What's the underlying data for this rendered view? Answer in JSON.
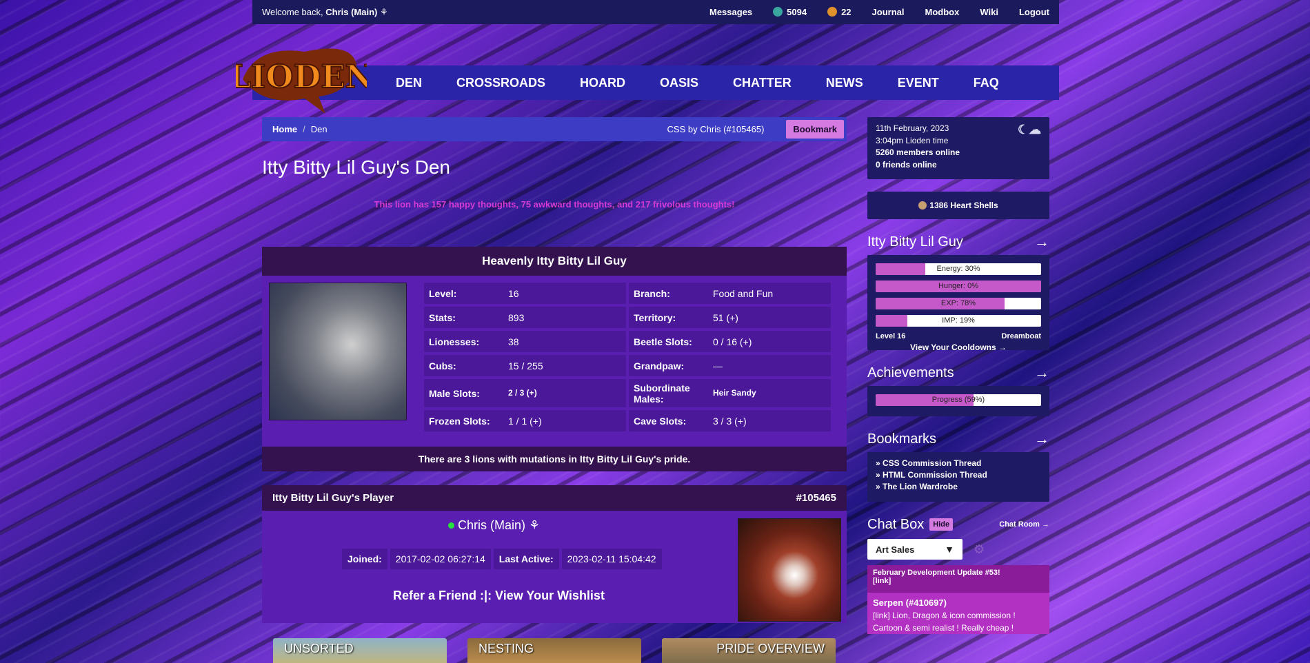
{
  "topbar": {
    "welcome_prefix": "Welcome back,",
    "user": "Chris (Main)",
    "messages": "Messages",
    "beetles": "5094",
    "gifts": "22",
    "journal": "Journal",
    "modbox": "Modbox",
    "wiki": "Wiki",
    "logout": "Logout"
  },
  "logo_text": "LIODEN",
  "nav": [
    "DEN",
    "CROSSROADS",
    "HOARD",
    "OASIS",
    "CHATTER",
    "NEWS",
    "EVENT",
    "FAQ"
  ],
  "breadcrumb": {
    "home": "Home",
    "sep": "/",
    "current": "Den",
    "css": "CSS by Chris (#105465)",
    "bookmark": "Bookmark"
  },
  "page_title": "Itty Bitty Lil Guy's Den",
  "thoughts": "This lion has 157 happy thoughts, 75 awkward thoughts, and 217 frivolous thoughts!",
  "lion": {
    "name": "Heavenly Itty Bitty Lil Guy",
    "stats": [
      {
        "k": "Level:",
        "v": "16"
      },
      {
        "k": "Branch:",
        "v": "Food and Fun"
      },
      {
        "k": "Stats:",
        "v": "893"
      },
      {
        "k": "Territory:",
        "v": "51 (+)"
      },
      {
        "k": "Lionesses:",
        "v": "38"
      },
      {
        "k": "Beetle Slots:",
        "v": "0 / 16 (+)"
      },
      {
        "k": "Cubs:",
        "v": "15 / 255"
      },
      {
        "k": "Grandpaw:",
        "v": "—"
      },
      {
        "k": "Male Slots:",
        "v": "2 / 3 (+)"
      },
      {
        "k": "Subordinate Males:",
        "v": "Heir Sandy"
      },
      {
        "k": "Frozen Slots:",
        "v": "1 / 1 (+)"
      },
      {
        "k": "Cave Slots:",
        "v": "3 / 3 (+)"
      }
    ],
    "mutation": "There are 3 lions with mutations in Itty Bitty Lil Guy's pride."
  },
  "player": {
    "heading": "Itty Bitty Lil Guy's Player",
    "id": "#105465",
    "name": "Chris (Main)",
    "joined_label": "Joined:",
    "joined": "2017-02-02 06:27:14",
    "active_label": "Last Active:",
    "active": "2023-02-11 15:04:42",
    "links": "Refer a Friend :|: View Your Wishlist"
  },
  "tabs": [
    "UNSORTED",
    "NESTING",
    "PRIDE OVERVIEW"
  ],
  "sidebar": {
    "date": "11th February, 2023",
    "time": "3:04pm Lioden time",
    "members": "5260 members online",
    "friends": "0 friends online",
    "shells": "1386 Heart Shells",
    "lion_title": "Itty Bitty Lil Guy",
    "bars": [
      {
        "label": "Energy: 30%",
        "pct": 30
      },
      {
        "label": "Hunger: 0%",
        "pct": 100
      },
      {
        "label": "EXP: 78%",
        "pct": 78
      },
      {
        "label": "IMP: 19%",
        "pct": 19
      }
    ],
    "level": "Level 16",
    "rank": "Dreamboat",
    "cooldowns": "View Your Cooldowns →",
    "achievements_title": "Achievements",
    "progress": {
      "label": "Progress (59%)",
      "pct": 59
    },
    "bookmarks_title": "Bookmarks",
    "bookmarks": [
      "» CSS Commission Thread",
      "» HTML Commission Thread",
      "» The Lion Wardrobe"
    ],
    "chat_title": "Chat Box",
    "hide": "Hide",
    "chat_room": "Chat Room →",
    "chat_select": "Art Sales",
    "news": "February Development Update #53!",
    "news_link": "[link]",
    "msg_user": "Serpen (#410697)",
    "msg_text": "[link] Lion, Dragon & icon commission ! Cartoon & semi realist ! Really cheap !"
  },
  "colors": {
    "accent": "#d57ae0",
    "bar_fill": "#c559c9",
    "panel": "#5a1fb0",
    "dark": "#33124f",
    "nav": "#2a24a8"
  }
}
